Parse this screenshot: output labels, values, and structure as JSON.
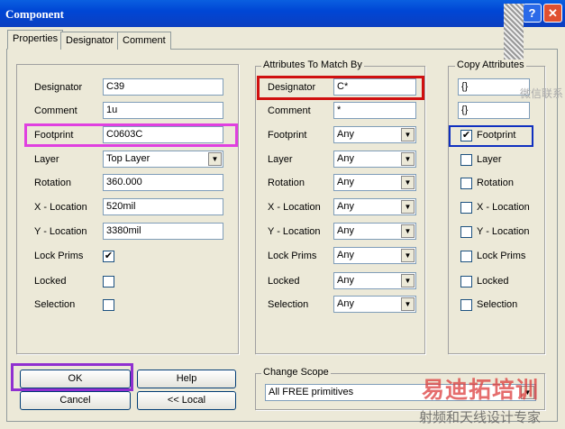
{
  "title": "Component",
  "tabs": [
    "Properties",
    "Designator",
    "Comment"
  ],
  "properties": {
    "rows": [
      {
        "label": "Designator",
        "value": "C39",
        "type": "input"
      },
      {
        "label": "Comment",
        "value": "1u",
        "type": "input"
      },
      {
        "label": "Footprint",
        "value": "C0603C",
        "type": "input"
      },
      {
        "label": "Layer",
        "value": "Top Layer",
        "type": "select"
      },
      {
        "label": "Rotation",
        "value": "360.000",
        "type": "input"
      },
      {
        "label": "X - Location",
        "value": "520mil",
        "type": "input"
      },
      {
        "label": "Y - Location",
        "value": "3380mil",
        "type": "input"
      },
      {
        "label": "Lock Prims",
        "checked": true,
        "type": "check"
      },
      {
        "label": "Locked",
        "checked": false,
        "type": "check"
      },
      {
        "label": "Selection",
        "checked": false,
        "type": "check"
      }
    ]
  },
  "match": {
    "title": "Attributes To Match By",
    "rows": [
      {
        "label": "Designator",
        "value": "C*",
        "type": "input"
      },
      {
        "label": "Comment",
        "value": "*",
        "type": "input"
      },
      {
        "label": "Footprint",
        "value": "Any"
      },
      {
        "label": "Layer",
        "value": "Any"
      },
      {
        "label": "Rotation",
        "value": "Any"
      },
      {
        "label": "X - Location",
        "value": "Any"
      },
      {
        "label": "Y - Location",
        "value": "Any"
      },
      {
        "label": "Lock Prims",
        "value": "Any"
      },
      {
        "label": "Locked",
        "value": "Any"
      },
      {
        "label": "Selection",
        "value": "Any"
      }
    ]
  },
  "copy": {
    "title": "Copy Attributes",
    "inputs": [
      "{}",
      "{}"
    ],
    "checks": [
      {
        "label": "Footprint",
        "checked": true
      },
      {
        "label": "Layer",
        "checked": false
      },
      {
        "label": "Rotation",
        "checked": false
      },
      {
        "label": "X - Location",
        "checked": false
      },
      {
        "label": "Y - Location",
        "checked": false
      },
      {
        "label": "Lock Prims",
        "checked": false
      },
      {
        "label": "Locked",
        "checked": false
      },
      {
        "label": "Selection",
        "checked": false
      }
    ]
  },
  "buttons": {
    "ok": "OK",
    "help": "Help",
    "cancel": "Cancel",
    "local": "<< Local"
  },
  "scope": {
    "title": "Change Scope",
    "value": "All FREE primitives"
  },
  "watermark": {
    "brand": "易迪拓培训",
    "slogan": "射频和天线设计专家",
    "contact": "微信联系"
  },
  "colors": {
    "title": "#0054e3",
    "magenta": "#e040e0",
    "red": "#d01010",
    "blue": "#1030c0",
    "purple": "#9030d0"
  }
}
